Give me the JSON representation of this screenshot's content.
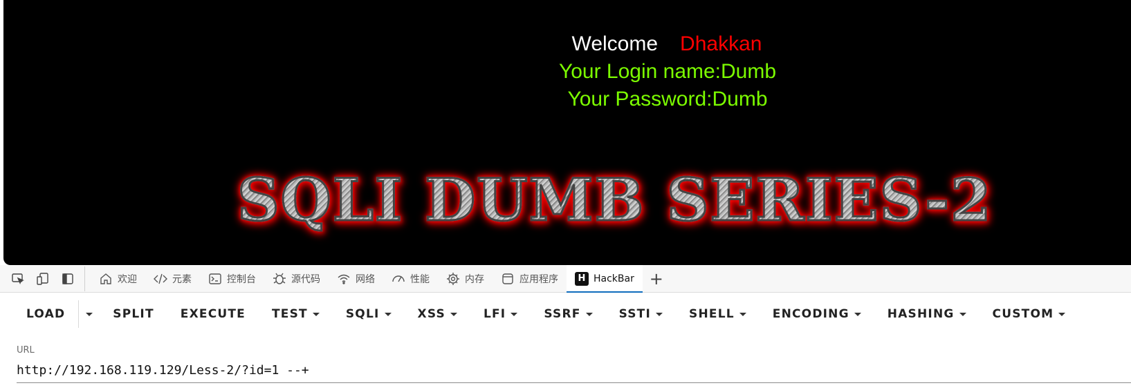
{
  "page": {
    "welcome_label": "Welcome",
    "user_name": "Dhakkan",
    "login_line": "Your Login name:Dumb",
    "password_line": "Your Password:Dumb",
    "banner": "SQLI DUMB SERIES-2",
    "colors": {
      "background": "#000000",
      "welcome": "#ffffff",
      "name": "#ff0000",
      "info": "#7cfc00"
    }
  },
  "devtools": {
    "tool_icons": [
      "inspect-icon",
      "device-emulation-icon",
      "dock-sidebar-icon"
    ],
    "tabs": [
      {
        "label": "欢迎",
        "icon": "home-icon"
      },
      {
        "label": "元素",
        "icon": "code-icon"
      },
      {
        "label": "控制台",
        "icon": "console-icon"
      },
      {
        "label": "源代码",
        "icon": "bug-icon"
      },
      {
        "label": "网络",
        "icon": "wifi-icon"
      },
      {
        "label": "性能",
        "icon": "gauge-icon"
      },
      {
        "label": "内存",
        "icon": "chip-icon"
      },
      {
        "label": "应用程序",
        "icon": "app-window-icon"
      },
      {
        "label": "HackBar",
        "icon": "hackbar-logo",
        "logo_letter": "H",
        "active": true
      }
    ],
    "add_tab": "+",
    "accent": "#0f6cbd"
  },
  "hackbar": {
    "buttons": {
      "load": "LOAD",
      "split": "SPLIT",
      "execute": "EXECUTE",
      "test": "TEST",
      "sqli": "SQLI",
      "xss": "XSS",
      "lfi": "LFI",
      "ssrf": "SSRF",
      "ssti": "SSTI",
      "shell": "SHELL",
      "encoding": "ENCODING",
      "hashing": "HASHING",
      "custom": "CUSTOM"
    },
    "url_label": "URL",
    "url_value": "http://192.168.119.129/Less-2/?id=1 --+"
  }
}
